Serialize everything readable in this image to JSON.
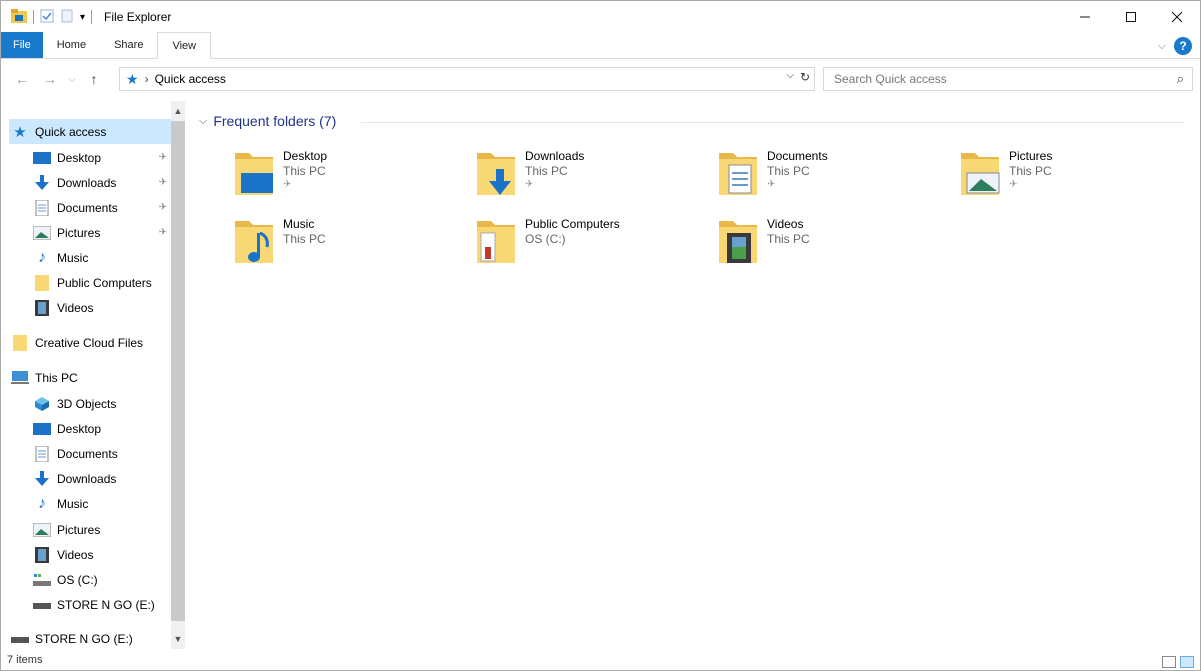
{
  "window": {
    "title": "File Explorer"
  },
  "ribbon": {
    "tabs": [
      {
        "label": "File"
      },
      {
        "label": "Home"
      },
      {
        "label": "Share"
      },
      {
        "label": "View"
      }
    ]
  },
  "address": {
    "breadcrumb": "Quick access",
    "search_placeholder": "Search Quick access"
  },
  "nav": {
    "quick_access": "Quick access",
    "items": [
      {
        "label": "Desktop"
      },
      {
        "label": "Downloads"
      },
      {
        "label": "Documents"
      },
      {
        "label": "Pictures"
      },
      {
        "label": "Music"
      },
      {
        "label": "Public Computers"
      },
      {
        "label": "Videos"
      },
      {
        "label": "Creative Cloud Files"
      },
      {
        "label": "This PC"
      },
      {
        "label": "3D Objects"
      },
      {
        "label": "Desktop"
      },
      {
        "label": "Documents"
      },
      {
        "label": "Downloads"
      },
      {
        "label": "Music"
      },
      {
        "label": "Pictures"
      },
      {
        "label": "Videos"
      },
      {
        "label": "OS (C:)"
      },
      {
        "label": "STORE N GO (E:)"
      },
      {
        "label": "STORE N GO (E:)"
      }
    ]
  },
  "main": {
    "group_title": "Frequent folders (7)",
    "folders": [
      {
        "name": "Desktop",
        "location": "This PC",
        "icon": "desktop-folder-icon"
      },
      {
        "name": "Downloads",
        "location": "This PC",
        "icon": "downloads-folder-icon"
      },
      {
        "name": "Documents",
        "location": "This PC",
        "icon": "documents-folder-icon"
      },
      {
        "name": "Pictures",
        "location": "This PC",
        "icon": "pictures-folder-icon"
      },
      {
        "name": "Music",
        "location": "This PC",
        "icon": "music-folder-icon"
      },
      {
        "name": "Public Computers",
        "location": "OS (C:)",
        "icon": "public-folder-icon"
      },
      {
        "name": "Videos",
        "location": "This PC",
        "icon": "videos-folder-icon"
      }
    ]
  },
  "status": {
    "item_count": "7 items"
  },
  "colors": {
    "accent": "#1979ca",
    "selection": "#cce8ff",
    "group_title": "#1e3287",
    "folder": "#f8d775"
  }
}
